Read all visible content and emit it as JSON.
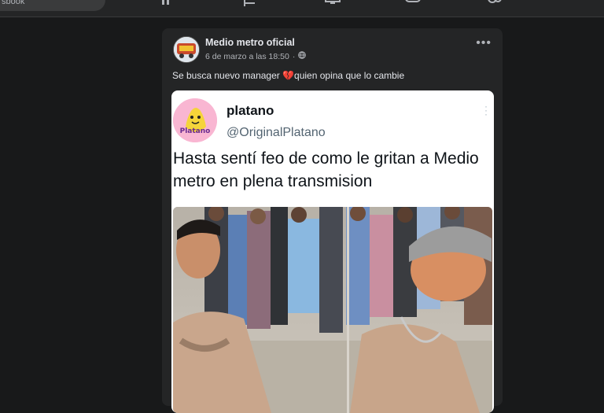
{
  "topbar": {
    "search_text": "sbook",
    "nav_icons": [
      "video-icon",
      "flag-icon",
      "marketplace-icon",
      "gaming-icon",
      "groups-icon"
    ]
  },
  "post": {
    "page_name": "Medio metro oficial",
    "timestamp": "6 de marzo a las 18:50",
    "audience_icon": "globe-icon",
    "caption_before": "Se busca nuevo manager ",
    "caption_emoji": "broken-heart-icon",
    "caption_after": "quien opina que lo cambie",
    "more_label": "•••"
  },
  "tweet": {
    "display_name": "platano",
    "handle": "@OriginalPlatano",
    "text": "Hasta sentí feo de como le gritan a Medio metro en plena transmision",
    "avatar_logo_text": "Platano"
  },
  "colors": {
    "page_bg": "#18191a",
    "card_bg": "#242526",
    "tweet_bg": "#ffffff",
    "accent_heart": "#e0245e"
  }
}
